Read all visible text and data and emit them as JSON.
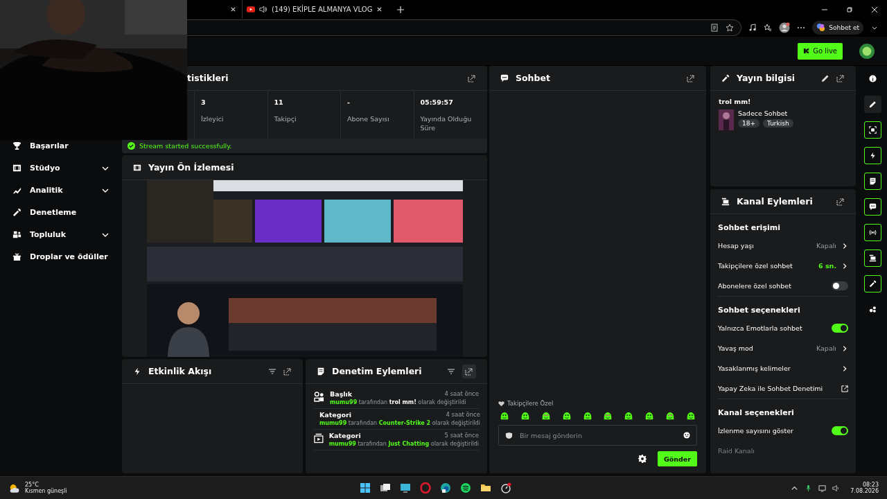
{
  "browser": {
    "tabs": [
      {
        "title": "(149) EKİPLE ALMANYA VLOG"
      }
    ],
    "copilot_button": "Sohbet et"
  },
  "header": {
    "go_live_button": "Go live"
  },
  "sidebar": {
    "items": [
      {
        "label": "Başarılar",
        "kind": "trophy",
        "has_submenu": false
      },
      {
        "label": "Stüdyo",
        "kind": "film",
        "has_submenu": true
      },
      {
        "label": "Analitik",
        "kind": "chart",
        "has_submenu": true
      },
      {
        "label": "Denetleme",
        "kind": "wrench",
        "has_submenu": false
      },
      {
        "label": "Topluluk",
        "kind": "people",
        "has_submenu": true
      },
      {
        "label": "Droplar ve ödüller",
        "kind": "gift",
        "has_submenu": false
      }
    ]
  },
  "stats": {
    "title": "tistikleri",
    "items": [
      {
        "value": "3",
        "label": "İzleyici"
      },
      {
        "value": "11",
        "label": "Takipçi"
      },
      {
        "value": "-",
        "label": "Abone Sayısı"
      },
      {
        "value": "05:59:57",
        "label": "Yayında Olduğu Süre"
      }
    ],
    "success_message": "Stream started successfully."
  },
  "preview": {
    "title": "Yayın Ön İzlemesi",
    "kind": "picture"
  },
  "activity_feed": {
    "title": "Etkinlik Akışı"
  },
  "moderation": {
    "title": "Denetim Eylemleri",
    "entries": [
      {
        "kind": "title",
        "title": "Başlık",
        "time": "4 saat önce",
        "user": "mumu99",
        "verb": "tarafından",
        "value": "trol mm!",
        "suffix": "olarak değiştirildi"
      },
      {
        "kind": "category",
        "title": "Kategori",
        "time": "4 saat önce",
        "user": "mumu99",
        "verb": "tarafından",
        "value": "Counter-Strike 2",
        "suffix": "olarak değiştirildi"
      },
      {
        "kind": "category",
        "title": "Kategori",
        "time": "5 saat önce",
        "user": "mumu99",
        "verb": "tarafından",
        "value": "Just Chatting",
        "suffix": "olarak değiştirildi"
      }
    ]
  },
  "chat": {
    "title": "Sohbet",
    "followers_label": "Takipçilere Özel",
    "placeholder": "Bir mesaj gönderin",
    "send_button": "Gönder"
  },
  "stream_info": {
    "title": "Yayın bilgisi",
    "stream_title": "trol mm!",
    "category": "Sadece Sohbet",
    "tags": [
      "18+",
      "Turkish"
    ]
  },
  "channel_actions": {
    "title": "Kanal Eylemleri",
    "sections": [
      {
        "heading": "Sohbet erişimi",
        "rows": [
          {
            "kind": "link",
            "label": "Hesap yaşı",
            "value": "Kapalı",
            "highlighted": false
          },
          {
            "kind": "link",
            "label": "Takipçilere özel sohbet",
            "value": "6 sn.",
            "highlighted": true
          },
          {
            "kind": "toggle",
            "label": "Abonelere özel sohbet",
            "on": false
          }
        ]
      },
      {
        "heading": "Sohbet seçenekleri",
        "rows": [
          {
            "kind": "toggle",
            "label": "Yalnızca Emotlarla sohbet",
            "on": true
          },
          {
            "kind": "link",
            "label": "Yavaş mod",
            "value": "Kapalı",
            "highlighted": false
          },
          {
            "kind": "link",
            "label": "Yasaklanmış kelimeler"
          },
          {
            "kind": "external",
            "label": "Yapay Zeka ile Sohbet Denetimi"
          }
        ]
      },
      {
        "heading": "Kanal seçenekleri",
        "rows": [
          {
            "kind": "toggle",
            "label": "İzlenme sayısını göster",
            "on": true
          },
          {
            "kind": "disabled",
            "label": "Raid Kanalı"
          }
        ]
      }
    ]
  },
  "rail": {
    "icons": [
      {
        "kind": "info",
        "active": false
      },
      {
        "kind": "pencil",
        "active": false
      },
      {
        "kind": "capture",
        "active": true
      },
      {
        "kind": "bolt",
        "active": true
      },
      {
        "kind": "note",
        "active": true
      },
      {
        "kind": "chat",
        "active": true
      },
      {
        "kind": "broadcast",
        "active": true
      },
      {
        "kind": "channel",
        "active": true
      },
      {
        "kind": "wrench",
        "active": true
      },
      {
        "kind": "dots",
        "active": false
      }
    ]
  },
  "taskbar": {
    "temperature": "25°C",
    "weather": "Kısmen güneşli",
    "time": "08:23",
    "date": "7.08.2026"
  }
}
